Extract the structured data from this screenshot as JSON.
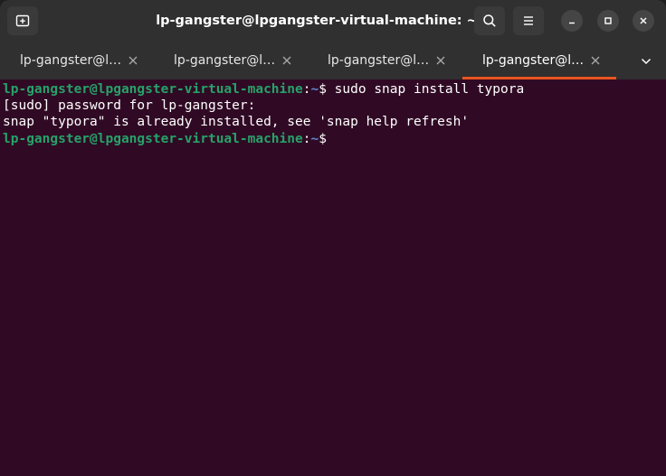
{
  "window": {
    "title": "lp-gangster@lpgangster-virtual-machine: ~"
  },
  "tabs": [
    {
      "label": "lp-gangster@lpgangster-virtual-machine: ~",
      "active": false
    },
    {
      "label": "lp-gangster@lpgangster-virtual-machine: ~",
      "active": false
    },
    {
      "label": "lp-gangster@lpgangster-virtual-machine: ~",
      "active": false
    },
    {
      "label": "lp-gangster@lpgangster-virtual-machine: ~",
      "active": true
    }
  ],
  "terminal": {
    "prompt_user_host": "lp-gangster@lpgangster-virtual-machine",
    "prompt_colon": ":",
    "prompt_path": "~",
    "prompt_symbol": "$",
    "command": " sudo snap install typora",
    "output_line_1": "[sudo] password for lp-gangster:",
    "output_line_2": "snap \"typora\" is already installed, see 'snap help refresh'"
  },
  "icons": {
    "new_tab": "new-tab-icon",
    "search": "search-icon",
    "menu": "hamburger-menu-icon",
    "minimize": "minimize-icon",
    "maximize": "maximize-icon",
    "close": "close-icon",
    "tab_close": "close-icon",
    "tabs_menu": "chevron-down-icon"
  },
  "colors": {
    "terminal_background": "#300a24",
    "prompt_user_host": "#26a269",
    "prompt_path": "#5f87d7",
    "active_tab_accent": "#e95420",
    "headerbar": "#303030"
  }
}
